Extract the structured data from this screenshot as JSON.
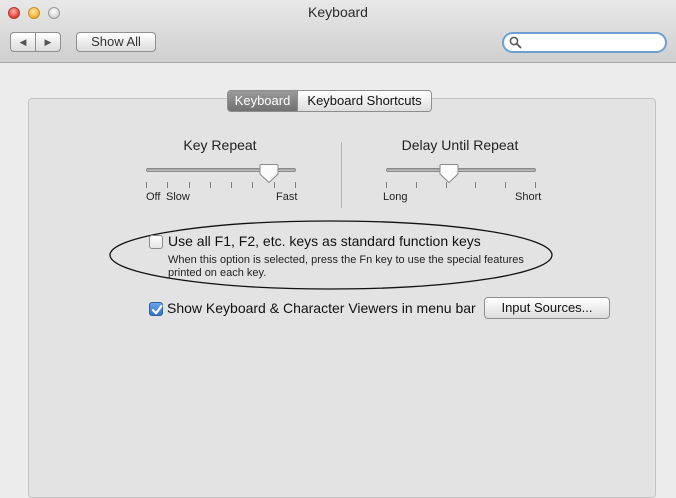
{
  "window": {
    "title": "Keyboard"
  },
  "toolbar": {
    "back_glyph": "◀",
    "forward_glyph": "▶",
    "show_all_label": "Show All",
    "search": {
      "value": "",
      "placeholder": "",
      "icon": "magnifier-icon"
    }
  },
  "tabs": [
    {
      "label": "Keyboard",
      "selected": true
    },
    {
      "label": "Keyboard Shortcuts",
      "selected": false
    }
  ],
  "key_repeat": {
    "heading": "Key Repeat",
    "labels": [
      "Off",
      "Slow",
      "Fast"
    ],
    "tick_count": 8,
    "value_fraction": 0.82
  },
  "delay_until_repeat": {
    "heading": "Delay Until Repeat",
    "labels": [
      "Long",
      "Short"
    ],
    "tick_count": 6,
    "value_fraction": 0.42
  },
  "function_keys": {
    "label": "Use all F1, F2, etc. keys as standard function keys",
    "help": "When this option is selected, press the Fn key to use the special features printed on each key.",
    "checked": false
  },
  "show_viewers": {
    "label": "Show Keyboard & Character Viewers in menu bar",
    "checked": true
  },
  "input_sources_button": {
    "label": "Input Sources..."
  },
  "colors": {
    "search_focus": "#6d9fd6",
    "checkbox_checked": "#2f74cf",
    "tab_selected": "#717171"
  }
}
